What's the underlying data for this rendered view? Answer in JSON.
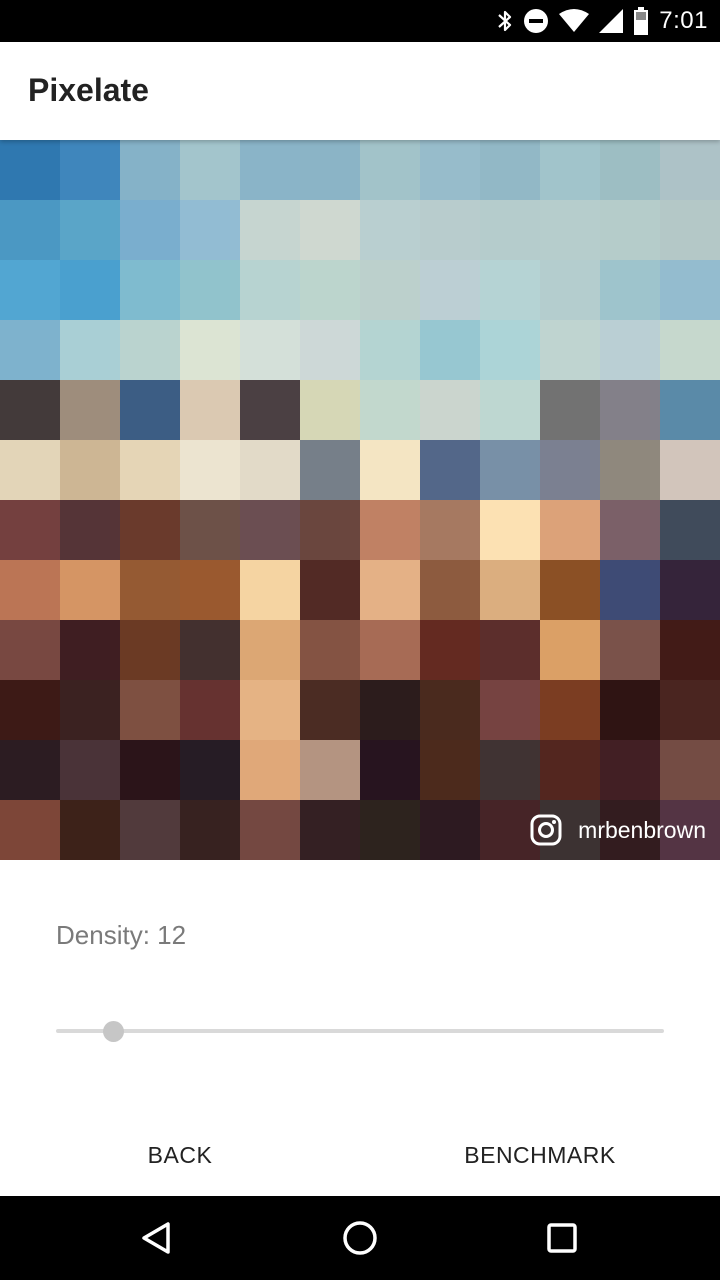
{
  "status_bar": {
    "time": "7:01",
    "icons": [
      "bluetooth-icon",
      "do-not-disturb-icon",
      "wifi-icon",
      "cell-signal-icon",
      "battery-icon"
    ]
  },
  "app_bar": {
    "title": "Pixelate"
  },
  "image": {
    "watermark_icon": "instagram-icon",
    "watermark_text": "mrbenbrown",
    "pixel_colors": [
      [
        "#2f78b0",
        "#3f86bc",
        "#85b2c8",
        "#a3c5cc",
        "#8ab4c8",
        "#8bb4c6",
        "#a2c3c9",
        "#97bccb",
        "#92b8c6",
        "#a1c4cb",
        "#9dbec3",
        "#adc2c7"
      ],
      [
        "#4b98c3",
        "#5aa5c8",
        "#7aaece",
        "#92bcd3",
        "#c6d5d0",
        "#cfd8d0",
        "#b9cfd0",
        "#b8cccd",
        "#b5cccc",
        "#b6cdcc",
        "#b5ccca",
        "#b4c8c7"
      ],
      [
        "#52a6d2",
        "#4aa0cf",
        "#7fbbcf",
        "#91c3cc",
        "#b7d3d1",
        "#bcd5cd",
        "#bcd0cc",
        "#bccfd4",
        "#b5d3d4",
        "#b4cdce",
        "#9ec4cc",
        "#94bccf"
      ],
      [
        "#7eb2cd",
        "#a9cfd5",
        "#bad3cf",
        "#dce4d3",
        "#d4e0d9",
        "#cdd8d7",
        "#b4d4d2",
        "#97c7d1",
        "#acd4d7",
        "#bfd4d0",
        "#bacfd4",
        "#c6d8cd"
      ],
      [
        "#433a3a",
        "#9e8d7c",
        "#3c5d84",
        "#dbc9b2",
        "#4b4043",
        "#d6d7b6",
        "#c2d8cd",
        "#cbd5ce",
        "#bed7d1",
        "#727272",
        "#838089",
        "#5a8aa8"
      ],
      [
        "#e3d5b8",
        "#cdb694",
        "#e5d5b6",
        "#ece4d0",
        "#e2dac8",
        "#767f89",
        "#f4e5c3",
        "#536789",
        "#7890a7",
        "#7b8091",
        "#8f887d",
        "#d2c5bb"
      ],
      [
        "#74403f",
        "#553437",
        "#6a3a2c",
        "#6d5148",
        "#6b4e52",
        "#6a463e",
        "#c08164",
        "#a67961",
        "#fce1b3",
        "#dca279",
        "#7b6068",
        "#404b5b"
      ],
      [
        "#bb7555",
        "#d59564",
        "#955a33",
        "#9a592f",
        "#f5d4a2",
        "#522a25",
        "#e4b186",
        "#8d5b3f",
        "#dbae7f",
        "#8b5025",
        "#3e4b75",
        "#35243a"
      ],
      [
        "#784841",
        "#3f1e22",
        "#6b3a24",
        "#43302f",
        "#dca774",
        "#845343",
        "#a76b55",
        "#642a21",
        "#5c2e2c",
        "#dba066",
        "#7a524a",
        "#421b17"
      ],
      [
        "#3d1a16",
        "#3b2221",
        "#7e5041",
        "#663230",
        "#e5b384",
        "#4b2c23",
        "#2c1c1c",
        "#4a2a1e",
        "#764341",
        "#7b3d22",
        "#2f1413",
        "#4a2520"
      ],
      [
        "#2c1c22",
        "#4a3338",
        "#2b1419",
        "#261c25",
        "#e0a879",
        "#b49481",
        "#27141f",
        "#4c2a1c",
        "#403333",
        "#53261f",
        "#421f24",
        "#744c44"
      ],
      [
        "#7d4638",
        "#3d2219",
        "#513a3c",
        "#372220",
        "#744841",
        "#342023",
        "#2d231e",
        "#2d1a21",
        "#462427",
        "#3c3232",
        "#331c1f",
        "#543444"
      ]
    ]
  },
  "controls": {
    "density_label": "Density: 12",
    "density_value": 12,
    "slider_fraction": 0.094
  },
  "actions": {
    "back_label": "BACK",
    "benchmark_label": "BENCHMARK"
  },
  "nav_bar": {
    "icons": [
      "back-icon",
      "home-icon",
      "recents-icon"
    ]
  }
}
